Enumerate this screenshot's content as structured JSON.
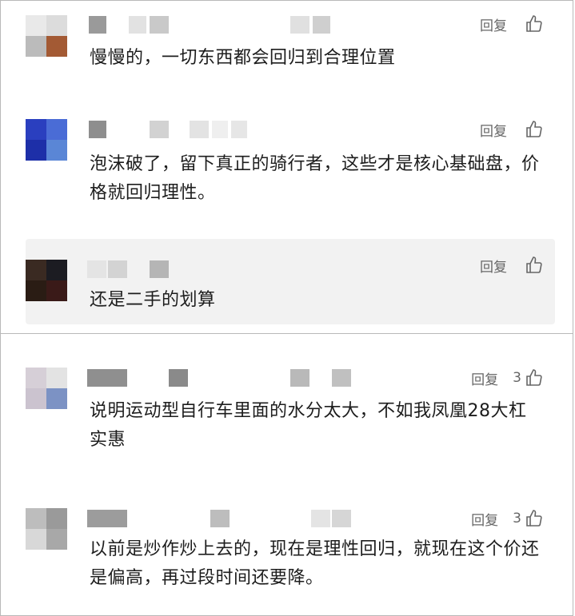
{
  "comments": [
    {
      "text": "慢慢的，一切东西都会回归到合理位置",
      "reply": "回复",
      "likes": ""
    },
    {
      "text": "泡沫破了，留下真正的骑行者，这些才是核心基础盘，价格就回归理性。",
      "reply": "回复",
      "likes": ""
    },
    {
      "text": "还是二手的划算",
      "reply": "回复",
      "likes": ""
    },
    {
      "text": "说明运动型自行车里面的水分太大，不如我凤凰28大杠实惠",
      "reply": "回复",
      "likes": "3"
    },
    {
      "text": "以前是炒作炒上去的，现在是理性回归，就现在这个价还是偏高，再过段时间还要降。",
      "reply": "回复",
      "likes": "3"
    }
  ],
  "icons": {
    "like": "thumbs-up-icon"
  },
  "colors": {
    "text": "#1d1d1d",
    "muted": "#666666",
    "highlight": "#f2f2f2",
    "border": "#b9b9b9"
  }
}
